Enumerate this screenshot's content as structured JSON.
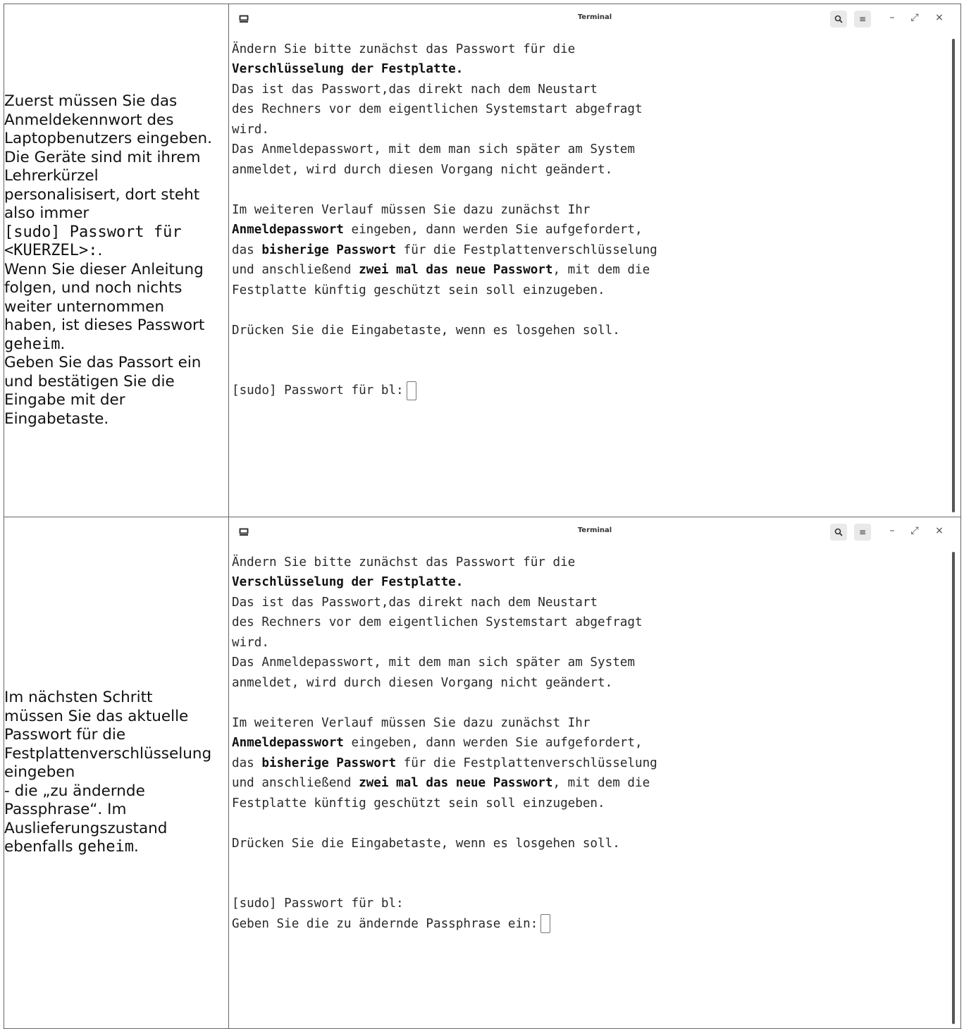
{
  "rows": [
    {
      "instructions": {
        "l1": "Zuerst müssen Sie das",
        "l2": "Anmeldekennwort des",
        "l3": "Laptopbenutzers eingeben.",
        "l4": "Die Geräte sind mit ihrem",
        "l5": "Lehrerkürzel",
        "l6": "personalisisert, dort steht",
        "l7": "also immer",
        "code1": "[sudo] Passwort für",
        "code2": "<KUERZEL>:",
        "code2_after": ".",
        "l8": "Wenn Sie dieser Anleitung",
        "l9": "folgen, und noch nichts",
        "l10": "weiter unternommen",
        "l11": "haben, ist dieses Passwort",
        "code3": "geheim",
        "code3_after": ".",
        "l12": "Geben Sie das Passort ein",
        "l13": "und bestätigen Sie die",
        "l14": "Eingabe mit der",
        "l15": "Eingabetaste."
      },
      "terminal": {
        "title": "Terminal",
        "lines": {
          "a1": "Ändern Sie bitte zunächst das Passwort für die",
          "a2": "Verschlüsselung der Festplatte",
          "a2_after": ".",
          "a3": "Das ist das Passwort,das direkt nach dem Neustart",
          "a4": "des Rechners vor dem eigentlichen Systemstart abgefragt",
          "a5": "wird.",
          "a6": "Das Anmeldepasswort, mit dem man sich später am System",
          "a7": "anmeldet, wird durch diesen Vorgang nicht geändert.",
          "b1": "Im weiteren Verlauf müssen Sie dazu zunächst Ihr",
          "b2_bold": "Anmeldepasswort",
          "b2_rest": " eingeben, dann werden Sie aufgefordert,",
          "b3_pre": "das ",
          "b3_bold": "bisherige Passwort",
          "b3_rest": " für die Festplattenverschlüsselung",
          "b4_pre": "und anschließend ",
          "b4_bold": "zwei mal das neue Passwort",
          "b4_rest": ", mit dem die",
          "b5": "Festplatte künftig geschützt sein soll einzugeben.",
          "c1": "Drücken Sie die Eingabetaste, wenn es losgehen soll.",
          "p1": "[sudo] Passwort für bl:"
        }
      }
    },
    {
      "instructions": {
        "l1": "Im nächsten Schritt",
        "l2": "müssen Sie das aktuelle",
        "l3": "Passwort für die",
        "l4": "Festplattenverschlüsselung",
        "l5": "eingeben",
        "l6": "- die „zu ändernde",
        "l7": "Passphrase“. Im",
        "l8": "Auslieferungszustand",
        "l9_pre": "ebenfalls ",
        "code": "geheim",
        "code_after": "."
      },
      "terminal": {
        "title": "Terminal",
        "lines": {
          "a1": "Ändern Sie bitte zunächst das Passwort für die",
          "a2": "Verschlüsselung der Festplatte",
          "a2_after": ".",
          "a3": "Das ist das Passwort,das direkt nach dem Neustart",
          "a4": "des Rechners vor dem eigentlichen Systemstart abgefragt",
          "a5": "wird.",
          "a6": "Das Anmeldepasswort, mit dem man sich später am System",
          "a7": "anmeldet, wird durch diesen Vorgang nicht geändert.",
          "b1": "Im weiteren Verlauf müssen Sie dazu zunächst Ihr",
          "b2_bold": "Anmeldepasswort",
          "b2_rest": " eingeben, dann werden Sie aufgefordert,",
          "b3_pre": "das ",
          "b3_bold": "bisherige Passwort",
          "b3_rest": " für die Festplattenverschlüsselung",
          "b4_pre": "und anschließend ",
          "b4_bold": "zwei mal das neue Passwort",
          "b4_rest": ", mit dem die",
          "b5": "Festplatte künftig geschützt sein soll einzugeben.",
          "c1": "Drücken Sie die Eingabetaste, wenn es losgehen soll.",
          "p1": "[sudo] Passwort für bl:",
          "p2": "Geben Sie die zu ändernde Passphrase ein:"
        }
      }
    }
  ],
  "icons": {
    "terminal": "terminal-icon",
    "search": "search-icon",
    "menu": "hamburger-menu-icon",
    "minimize": "minimize-icon",
    "maximize": "maximize-icon",
    "close": "close-icon"
  }
}
